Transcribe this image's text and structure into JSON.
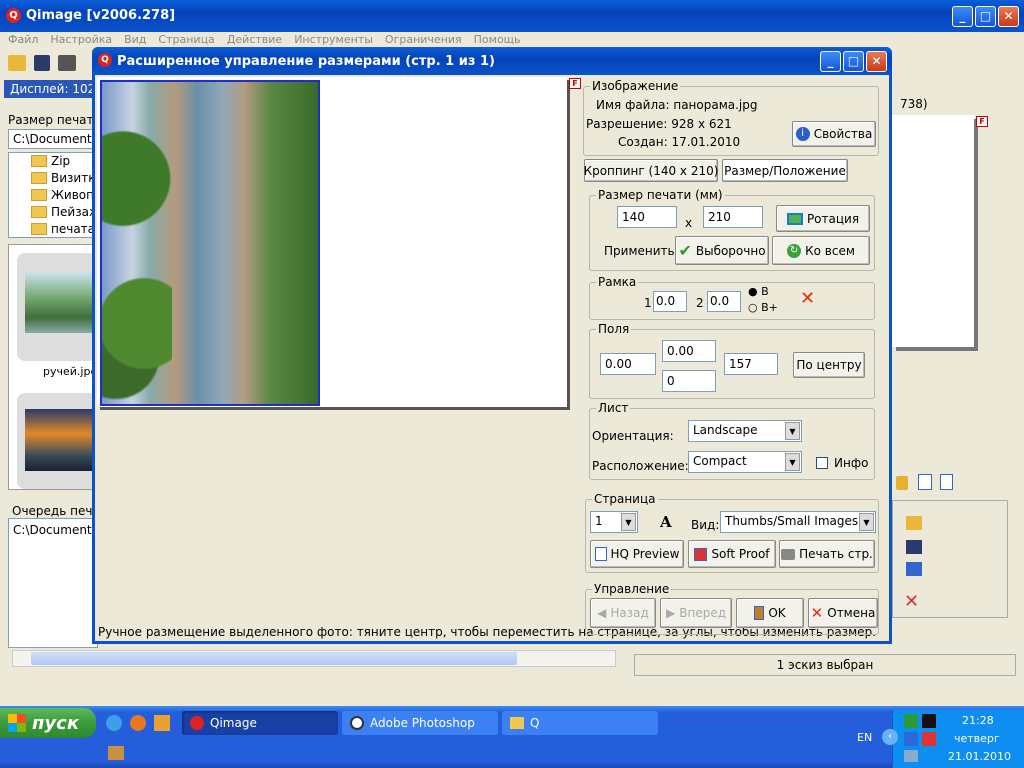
{
  "main": {
    "title": "Qimage [v2006.278]",
    "menu": [
      "Файл",
      "Настройка",
      "Вид",
      "Страница",
      "Действие",
      "Инструменты",
      "Ограничения",
      "Помощь"
    ],
    "display_label": "Дисплей: 102",
    "print_size_label": "Размер печат",
    "path": "C:\\Documents",
    "tree": [
      "Zip",
      "Визитк",
      "Живоп",
      "Пейзаж",
      "печата"
    ],
    "thumb_caption": "ручей.jpg",
    "queue_label": "Очередь печ",
    "queue_path": "C:\\Document",
    "right_header": "738)",
    "status": "1 эскиз выбран"
  },
  "dialog": {
    "title": "Расширенное управление размерами (стр. 1 из 1)",
    "image": {
      "legend": "Изображение",
      "filename": "Имя файла: панорама.jpg",
      "resolution": "Разрешение: 928 x 621",
      "created": "Создан: 17.01.2010",
      "props_btn": "Свойства"
    },
    "tabs": [
      "Кроппинг (140 x 210)",
      "Размер/Положение"
    ],
    "print_size": {
      "legend": "Размер печати (мм)",
      "width": "140",
      "x": "x",
      "height": "210",
      "rotate_btn": "Ротация",
      "apply_label": "Применить:",
      "selective_btn": "Выборочно",
      "all_btn": "Ко всем"
    },
    "frame": {
      "legend": "Рамка",
      "n1": "1",
      "v1": "0.0",
      "n2": "2",
      "v2": "0.0",
      "opt_b": "B",
      "opt_bplus": "B+"
    },
    "margins": {
      "legend": "Поля",
      "left": "0.00",
      "top": "0.00",
      "bottom": "0",
      "right": "157",
      "center_btn": "По центру"
    },
    "sheet": {
      "legend": "Лист",
      "orientation_label": "Ориентация:",
      "orientation": "Landscape",
      "layout_label": "Расположение:",
      "layout": "Compact",
      "info_label": "Инфо"
    },
    "page": {
      "legend": "Страница",
      "page_num": "1",
      "font_icon": "A",
      "view_label": "Вид:",
      "view": "Thumbs/Small Images",
      "hq_btn": "HQ Preview",
      "soft_btn": "Soft Proof",
      "print_btn": "Печать стр."
    },
    "control": {
      "legend": "Управление",
      "back_btn": "Назад",
      "forward_btn": "Вперед",
      "ok_btn": "OK",
      "cancel_btn": "Отмена"
    },
    "status": "Ручное размещение выделенного фото: тяните центр, чтобы переместить на странице, за углы, чтобы изменить размер."
  },
  "taskbar": {
    "start": "пуск",
    "tasks": [
      "Qimage",
      "Adobe Photoshop",
      "Q"
    ],
    "lang": "EN",
    "time": "21:28",
    "day": "четверг",
    "date": "21.01.2010"
  }
}
